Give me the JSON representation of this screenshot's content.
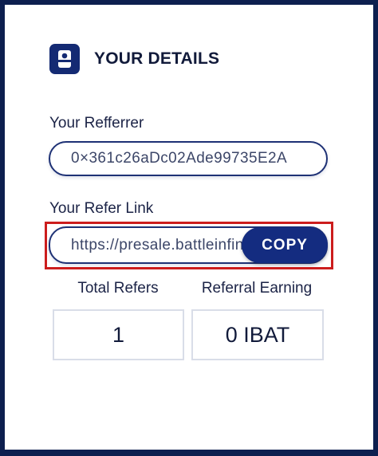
{
  "header": {
    "title": "YOUR DETAILS",
    "icon": "user-icon"
  },
  "referrer": {
    "label": "Your Refferrer",
    "value": "0×361c26aDc02Ade99735E2A"
  },
  "refer_link": {
    "label": "Your Refer Link",
    "value": "https://presale.battleinfinity.io",
    "copy_label": "COPY"
  },
  "stats": {
    "total_refers_label": "Total Refers",
    "total_refers_value": "1",
    "referral_earning_label": "Referral Earning",
    "referral_earning_value": "0 IBAT"
  },
  "colors": {
    "frame": "#0d1f4f",
    "accent": "#142c80",
    "highlight": "#cc1d1d"
  }
}
